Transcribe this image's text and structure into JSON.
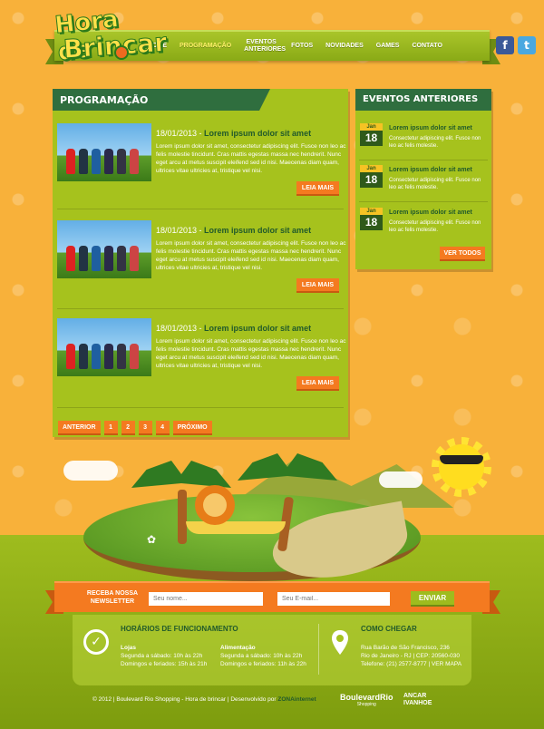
{
  "logo": {
    "line1": "Hora de",
    "line2": "Brincar"
  },
  "nav": {
    "items": [
      {
        "label": "HOME",
        "active": false
      },
      {
        "label": "PROGRAMAÇÃO",
        "active": true
      },
      {
        "label": "EVENTOS ANTERIORES",
        "active": false
      },
      {
        "label": "FOTOS",
        "active": false
      },
      {
        "label": "NOVIDADES",
        "active": false
      },
      {
        "label": "GAMES",
        "active": false
      },
      {
        "label": "CONTATO",
        "active": false
      }
    ],
    "social": {
      "facebook": "f",
      "twitter": "t"
    }
  },
  "programacao": {
    "title": "PROGRAMAÇÃO",
    "posts": [
      {
        "date": "18/01/2013",
        "separator": " - ",
        "headline": "Lorem ipsum dolor sit amet",
        "text": "Lorem ipsum dolor sit amet, consectetur adipiscing elit. Fusce non leo ac felis molestie tincidunt. Cras mattis egestas massa nec hendrerit. Nunc eget arcu at metus suscipit eleifend sed id nisi. Maecenas diam quam, ultrices vitae ultricies at, tristique vel nisi.",
        "button": "LEIA MAIS"
      },
      {
        "date": "18/01/2013",
        "separator": " - ",
        "headline": "Lorem ipsum dolor sit amet",
        "text": "Lorem ipsum dolor sit amet, consectetur adipiscing elit. Fusce non leo ac felis molestie tincidunt. Cras mattis egestas massa nec hendrerit. Nunc eget arcu at metus suscipit eleifend sed id nisi. Maecenas diam quam, ultrices vitae ultricies at, tristique vel nisi.",
        "button": "LEIA MAIS"
      },
      {
        "date": "18/01/2013",
        "separator": " - ",
        "headline": "Lorem ipsum dolor sit amet",
        "text": "Lorem ipsum dolor sit amet, consectetur adipiscing elit. Fusce non leo ac felis molestie tincidunt. Cras mattis egestas massa nec hendrerit. Nunc eget arcu at metus suscipit eleifend sed id nisi. Maecenas diam quam, ultrices vitae ultricies at, tristique vel nisi.",
        "button": "LEIA MAIS"
      }
    ],
    "pagination": {
      "prev": "ANTERIOR",
      "pages": [
        "1",
        "2",
        "3",
        "4"
      ],
      "next": "PRÓXIMO"
    }
  },
  "eventos": {
    "title": "EVENTOS ANTERIORES",
    "items": [
      {
        "month": "Jan",
        "day": "18",
        "title": "Lorem ipsum dolor sit amet",
        "text": "Consectetur adipiscing elit. Fusce non leo ac felis molestie."
      },
      {
        "month": "Jan",
        "day": "18",
        "title": "Lorem ipsum dolor sit amet",
        "text": "Consectetur adipiscing elit. Fusce non leo ac felis molestie."
      },
      {
        "month": "Jan",
        "day": "18",
        "title": "Lorem ipsum dolor sit amet",
        "text": "Consectetur adipiscing elit. Fusce non leo ac felis molestie."
      }
    ],
    "see_all": "VER TODOS"
  },
  "newsletter": {
    "label_line1": "RECEBA NOSSA",
    "label_line2": "NEWSLETTER",
    "name_placeholder": "Seu nome...",
    "email_placeholder": "Seu E-mail...",
    "send": "ENVIAR"
  },
  "hours": {
    "title": "HORÁRIOS DE FUNCIONAMENTO",
    "lojas": {
      "head": "Lojas",
      "line1": "Segunda a sábado: 10h às 22h",
      "line2": "Domingos e feriados: 15h às 21h"
    },
    "alimentacao": {
      "head": "Alimentação",
      "line1": "Segunda a sábado: 10h às 22h",
      "line2": "Domingos e feriados: 11h às 22h"
    }
  },
  "location": {
    "title": "COMO CHEGAR",
    "line1": "Rua Barão de São Francisco, 236",
    "line2": "Rio de Janeiro - RJ | CEP: 20560-030",
    "line3": "Telefone: (21) 2577-8777 | VER MAPA"
  },
  "footer": {
    "copyright": "© 2012 | Boulevard Rio Shopping - Hora de brincar | Desenvolvido por ",
    "agency": "ZONAinternet",
    "logo1": "BoulevardRio",
    "logo1_sub": "Shopping",
    "logo2_line1": "ANCAR",
    "logo2_line2": "IVANHOE"
  },
  "colors": {
    "background": "#f8b13a",
    "panel_green": "#a6c21d",
    "header_dark_green": "#2f6e3e",
    "button_orange": "#f47a20"
  }
}
